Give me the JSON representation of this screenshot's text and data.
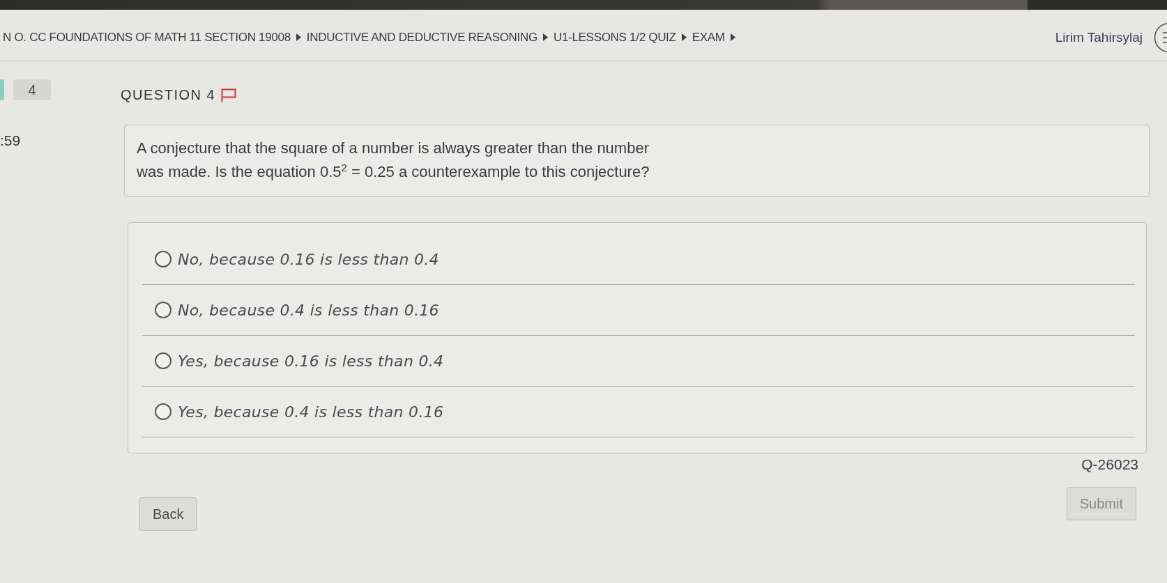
{
  "breadcrumbs": [
    {
      "label": "N O. CC FOUNDATIONS OF MATH 11 SECTION 19008"
    },
    {
      "label": "INDUCTIVE AND DEDUCTIVE REASONING"
    },
    {
      "label": "U1-LESSONS 1/2 QUIZ"
    },
    {
      "label": "EXAM"
    }
  ],
  "user": {
    "name": "Lirim Tahirsylaj"
  },
  "question_tiles": [
    {
      "answered": true
    },
    {
      "label": "4",
      "answered": false
    }
  ],
  "timer": ":59",
  "question": {
    "heading": "QUESTION 4",
    "flagged": false,
    "text": "A conjecture that the square of a number is always greater than the number\nwas made. Is the equation 0.5$^{2}$ = 0.25 a counterexample to this conjecture?",
    "options": [
      {
        "label": "No, because 0.16 is less than 0.4",
        "selected": false
      },
      {
        "label": "No, because 0.4 is less than 0.16",
        "selected": false
      },
      {
        "label": "Yes, because 0.16 is less than 0.4",
        "selected": false
      },
      {
        "label": "Yes, because 0.4 is less than 0.16",
        "selected": false
      }
    ],
    "id": "Q-26023"
  },
  "buttons": [
    {
      "label": "Back",
      "kind": "back",
      "disabled": false
    },
    {
      "label": "Submit",
      "kind": "submit",
      "disabled": true
    }
  ]
}
